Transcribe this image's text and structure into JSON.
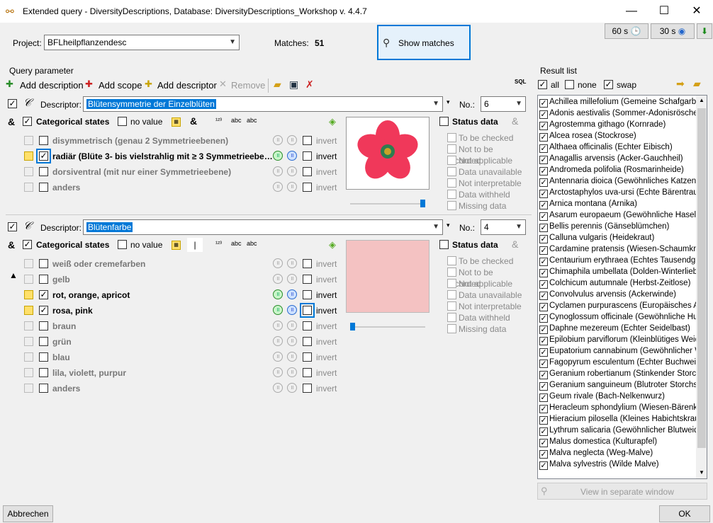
{
  "window": {
    "title": "Extended query - DiversityDescriptions,  Database: DiversityDescriptions_Workshop    v. 4.4.7"
  },
  "toolbar": {
    "timer1": "60 s",
    "timer2": "30 s"
  },
  "project": {
    "label": "Project:",
    "value": "BFLheilpflanzendesc"
  },
  "matches": {
    "label": "Matches:",
    "count": "51"
  },
  "show_matches": "Show matches",
  "query_parameter": {
    "title": "Query parameter",
    "add_description": "Add description",
    "add_scope": "Add scope",
    "add_descriptor": "Add descriptor",
    "remove": "Remove",
    "sql": "SQL"
  },
  "descriptor1": {
    "label": "Descriptor:",
    "value": "Blütensymmetrie der Einzelblüten",
    "no_label": "No.:",
    "no_value": "6",
    "cat_states": "Categorical states",
    "no_value_label": "no value",
    "amp": "&",
    "states": [
      {
        "label": "disymmetrisch (genau 2 Symmetrieebenen)",
        "checked": false,
        "invert": "invert"
      },
      {
        "label": "radiär (Blüte 3- bis vielstrahlig mit ≥ 3 Symmetrieebe…",
        "checked": true,
        "invert": "invert"
      },
      {
        "label": "dorsiventral (mit nur einer Symmetrieebene)",
        "checked": false,
        "invert": "invert"
      },
      {
        "label": "anders",
        "checked": false,
        "invert": "invert"
      }
    ],
    "status_title": "Status data",
    "status_items": [
      "To be checked",
      "Not to be recorded",
      "Not applicable",
      "Data unavailable",
      "Not interpretable",
      "Data withheld",
      "Missing data"
    ]
  },
  "descriptor2": {
    "label": "Descriptor:",
    "value": "Blütenfarbe",
    "no_label": "No.:",
    "no_value": "4",
    "cat_states": "Categorical states",
    "no_value_label": "no value",
    "bar": "|",
    "states": [
      {
        "label": "weiß oder cremefarben",
        "checked": false,
        "invert": "invert"
      },
      {
        "label": "gelb",
        "checked": false,
        "invert": "invert"
      },
      {
        "label": "rot, orange, apricot",
        "checked": true,
        "invert": "invert"
      },
      {
        "label": "rosa, pink",
        "checked": true,
        "invert": "invert"
      },
      {
        "label": "braun",
        "checked": false,
        "invert": "invert"
      },
      {
        "label": "grün",
        "checked": false,
        "invert": "invert"
      },
      {
        "label": "blau",
        "checked": false,
        "invert": "invert"
      },
      {
        "label": "lila, violett, purpur",
        "checked": false,
        "invert": "invert"
      },
      {
        "label": "anders",
        "checked": false,
        "invert": "invert"
      }
    ],
    "status_title": "Status data",
    "status_items": [
      "To be checked",
      "Not to be recorded",
      "Not applicable",
      "Data unavailable",
      "Not interpretable",
      "Data withheld",
      "Missing data"
    ]
  },
  "result_list": {
    "title": "Result list",
    "all": "all",
    "none": "none",
    "swap": "swap",
    "view_separate": "View in separate window",
    "items": [
      "Achillea millefolium (Gemeine Schafgarbe)",
      "Adonis aestivalis (Sommer-Adonisröschen)",
      "Agrostemma githago (Kornrade)",
      "Alcea rosea (Stockrose)",
      "Althaea officinalis (Echter Eibisch)",
      "Anagallis arvensis (Acker-Gauchheil)",
      "Andromeda polifolia (Rosmarinheide)",
      "Antennaria dioica (Gewöhnliches Katzenpfö",
      "Arctostaphylos uva-ursi (Echte Bärentraube",
      "Arnica montana (Arnika)",
      "Asarum europaeum (Gewöhnliche Haselwur",
      "Bellis perennis (Gänseblümchen)",
      "Calluna vulgaris (Heidekraut)",
      "Cardamine pratensis (Wiesen-Schaumkraut",
      "Centaurium erythraea (Echtes Tausendgüld",
      "Chimaphila umbellata (Dolden-Winterlieb)",
      "Colchicum autumnale (Herbst-Zeitlose)",
      "Convolvulus arvensis (Ackerwinde)",
      "Cyclamen purpurascens (Europäisches Alpe",
      "Cynoglossum officinale (Gewöhnliche Hund",
      "Daphne mezereum (Echter Seidelbast)",
      "Epilobium parviflorum (Kleinblütiges Weiden",
      "Eupatorium cannabinum (Gewöhnlicher Wa",
      "Fagopyrum esculentum (Echter Buchweizer",
      "Geranium robertianum (Stinkender Storchsc",
      "Geranium sanguineum (Blutroter Storchschr",
      "Geum rivale (Bach-Nelkenwurz)",
      "Heracleum sphondylium (Wiesen-Bärenklau",
      "Hieracium pilosella (Kleines Habichtskraut)",
      "Lythrum salicaria (Gewöhnlicher Blutweideri",
      "Malus domestica (Kulturapfel)",
      "Malva neglecta (Weg-Malve)",
      "Malva sylvestris (Wilde Malve)"
    ]
  },
  "footer": {
    "cancel": "Abbrechen",
    "ok": "OK"
  }
}
